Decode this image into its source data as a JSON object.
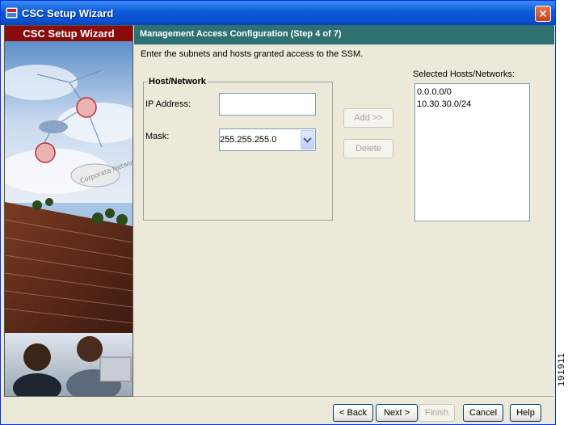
{
  "window": {
    "title": "CSC Setup Wizard",
    "close_label": "✕"
  },
  "sidebar": {
    "title": "CSC Setup Wizard",
    "image_label": "Corporate Network"
  },
  "header": {
    "title": "Management Access Configuration  (Step 4 of 7)"
  },
  "content": {
    "instruction": "Enter the subnets and hosts granted access to the SSM.",
    "group_title": "Host/Network",
    "ip_label": "IP Address:",
    "ip_value": "",
    "mask_label": "Mask:",
    "mask_value": "255.255.255.0",
    "add_button": "Add >>",
    "delete_button": "Delete",
    "selected_label": "Selected Hosts/Networks:",
    "selected_items": [
      "0.0.0.0/0",
      "10.30.30.0/24"
    ]
  },
  "footer": {
    "back": "< Back",
    "next": "Next >",
    "finish": "Finish",
    "cancel": "Cancel",
    "help": "Help"
  },
  "figure_id": "191911",
  "colors": {
    "title_bar": "#0b5bd8",
    "header_band": "#2f7070",
    "sidebar_title": "#8b0b0b",
    "dialog_bg": "#ece9d8"
  }
}
